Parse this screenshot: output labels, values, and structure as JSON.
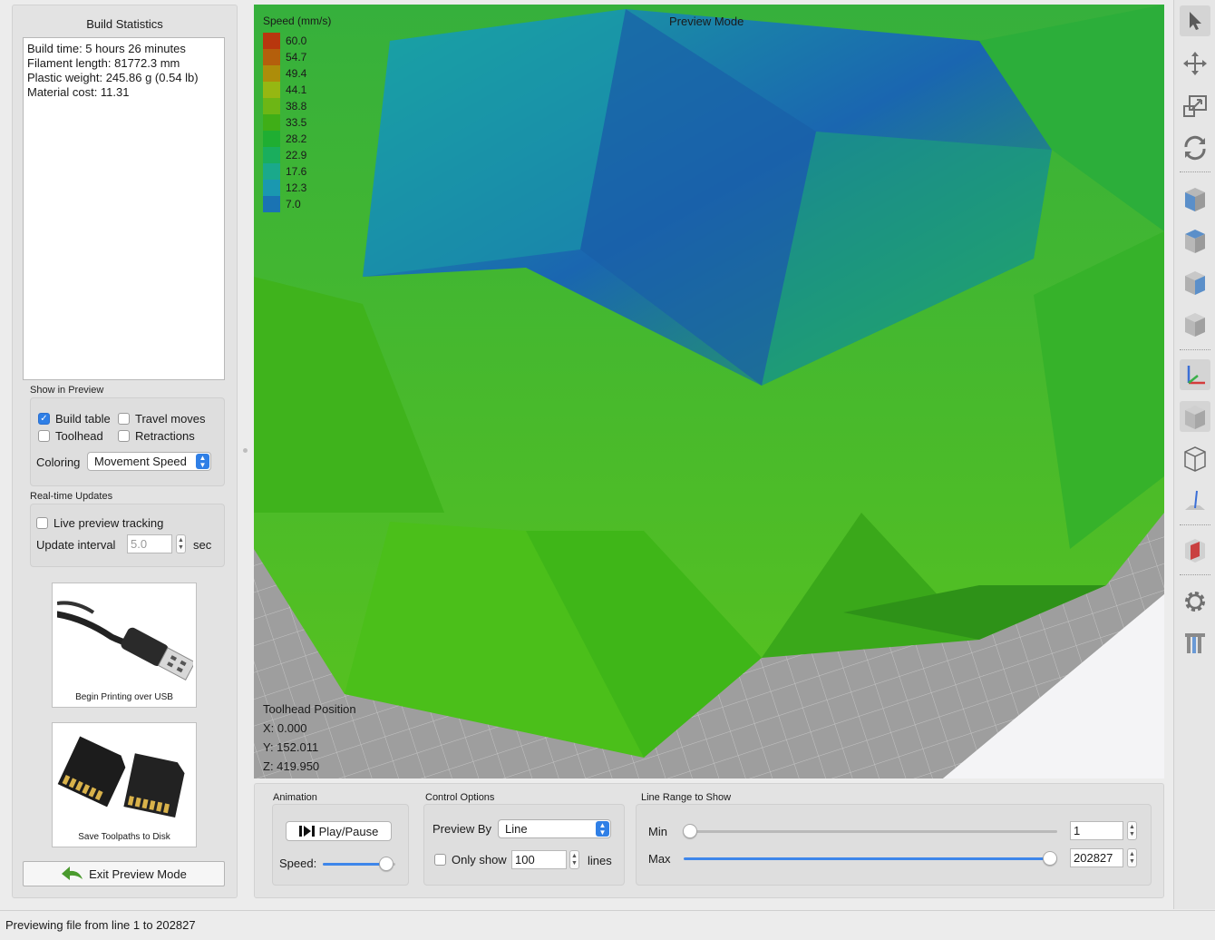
{
  "left_panel": {
    "stats_title": "Build Statistics",
    "stats": [
      "Build time: 5 hours 26 minutes",
      "Filament length: 81772.3 mm",
      "Plastic weight: 245.86 g (0.54 lb)",
      "Material cost: 11.31"
    ],
    "show_in_preview": {
      "label": "Show in Preview",
      "build_table": {
        "label": "Build table",
        "checked": true
      },
      "travel_moves": {
        "label": "Travel moves",
        "checked": false
      },
      "toolhead": {
        "label": "Toolhead",
        "checked": false
      },
      "retractions": {
        "label": "Retractions",
        "checked": false
      },
      "coloring_label": "Coloring",
      "coloring_value": "Movement Speed"
    },
    "realtime": {
      "label": "Real-time Updates",
      "live_tracking": {
        "label": "Live preview tracking",
        "checked": false
      },
      "interval_label": "Update interval",
      "interval_value": "5.0",
      "interval_unit": "sec"
    },
    "usb_button_label": "Begin Printing over USB",
    "disk_button_label": "Save Toolpaths to Disk",
    "exit_button_label": "Exit Preview Mode"
  },
  "viewport": {
    "mode_title": "Preview Mode",
    "legend_title": "Speed (mm/s)",
    "legend": [
      {
        "value": "60.0",
        "color": "#b8370e"
      },
      {
        "value": "54.7",
        "color": "#b45f0c"
      },
      {
        "value": "49.4",
        "color": "#ad8d0a"
      },
      {
        "value": "44.1",
        "color": "#96b712"
      },
      {
        "value": "38.8",
        "color": "#6db615"
      },
      {
        "value": "33.5",
        "color": "#3fae17"
      },
      {
        "value": "28.2",
        "color": "#1fae32"
      },
      {
        "value": "22.9",
        "color": "#1aae5d"
      },
      {
        "value": "17.6",
        "color": "#1aa98b"
      },
      {
        "value": "12.3",
        "color": "#1a98b0"
      },
      {
        "value": "7.0",
        "color": "#1a73b3"
      }
    ],
    "toolhead_title": "Toolhead Position",
    "toolhead_x": "X: 0.000",
    "toolhead_y": "Y: 152.011",
    "toolhead_z": "Z: 419.950"
  },
  "toolbar": {
    "icons": [
      "select-arrow-icon",
      "move-icon",
      "scale-icon",
      "rotate-icon",
      "view-front-cube-icon",
      "view-top-cube-icon",
      "view-side-cube-icon",
      "view-iso-cube-icon",
      "axes-icon",
      "solid-cube-icon",
      "wireframe-cube-icon",
      "z-axis-icon",
      "cross-section-icon",
      "settings-gear-icon",
      "layers-icon"
    ]
  },
  "bottom": {
    "animation": {
      "label": "Animation",
      "play_label": "Play/Pause",
      "speed_label": "Speed:",
      "speed_level": 0.87
    },
    "control": {
      "label": "Control Options",
      "preview_by_label": "Preview By",
      "preview_by_value": "Line",
      "only_show_label": "Only show",
      "only_show_value": "100",
      "lines_label": "lines",
      "only_show_checked": false
    },
    "range": {
      "label": "Line Range to Show",
      "min_label": "Min",
      "min_value": "1",
      "max_label": "Max",
      "max_value": "202827"
    }
  },
  "status_bar": {
    "text": "Previewing file from line 1 to 202827"
  }
}
